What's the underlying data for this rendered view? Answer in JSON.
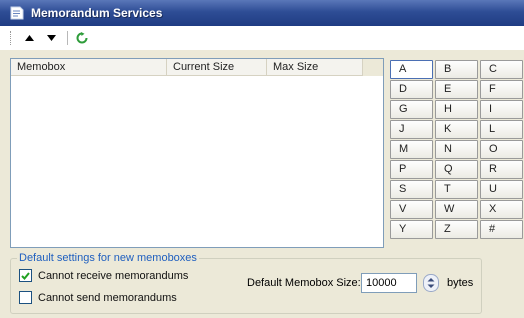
{
  "window": {
    "title": "Memorandum Services"
  },
  "listview": {
    "columns": [
      "Memobox",
      "Current Size",
      "Max Size"
    ]
  },
  "letters": [
    "A",
    "B",
    "C",
    "D",
    "E",
    "F",
    "G",
    "H",
    "I",
    "J",
    "K",
    "L",
    "M",
    "N",
    "O",
    "P",
    "Q",
    "R",
    "S",
    "T",
    "U",
    "V",
    "W",
    "X",
    "Y",
    "Z",
    "#"
  ],
  "defaults": {
    "group_label": "Default settings for new memoboxes",
    "cannot_receive_label": "Cannot receive memorandums",
    "cannot_receive_checked": true,
    "cannot_send_label": "Cannot send memorandums",
    "cannot_send_checked": false,
    "size_label": "Default Memobox Size:",
    "size_value": "10000",
    "size_unit": "bytes"
  },
  "colors": {
    "titlebar": "#2e4d95",
    "accent_link": "#1f5fbf",
    "refresh_icon": "#2e9c3a"
  },
  "icons": {
    "title": "memo-window-icon",
    "toolbar": [
      "arrow-up-icon",
      "arrow-down-icon",
      "refresh-icon"
    ]
  }
}
